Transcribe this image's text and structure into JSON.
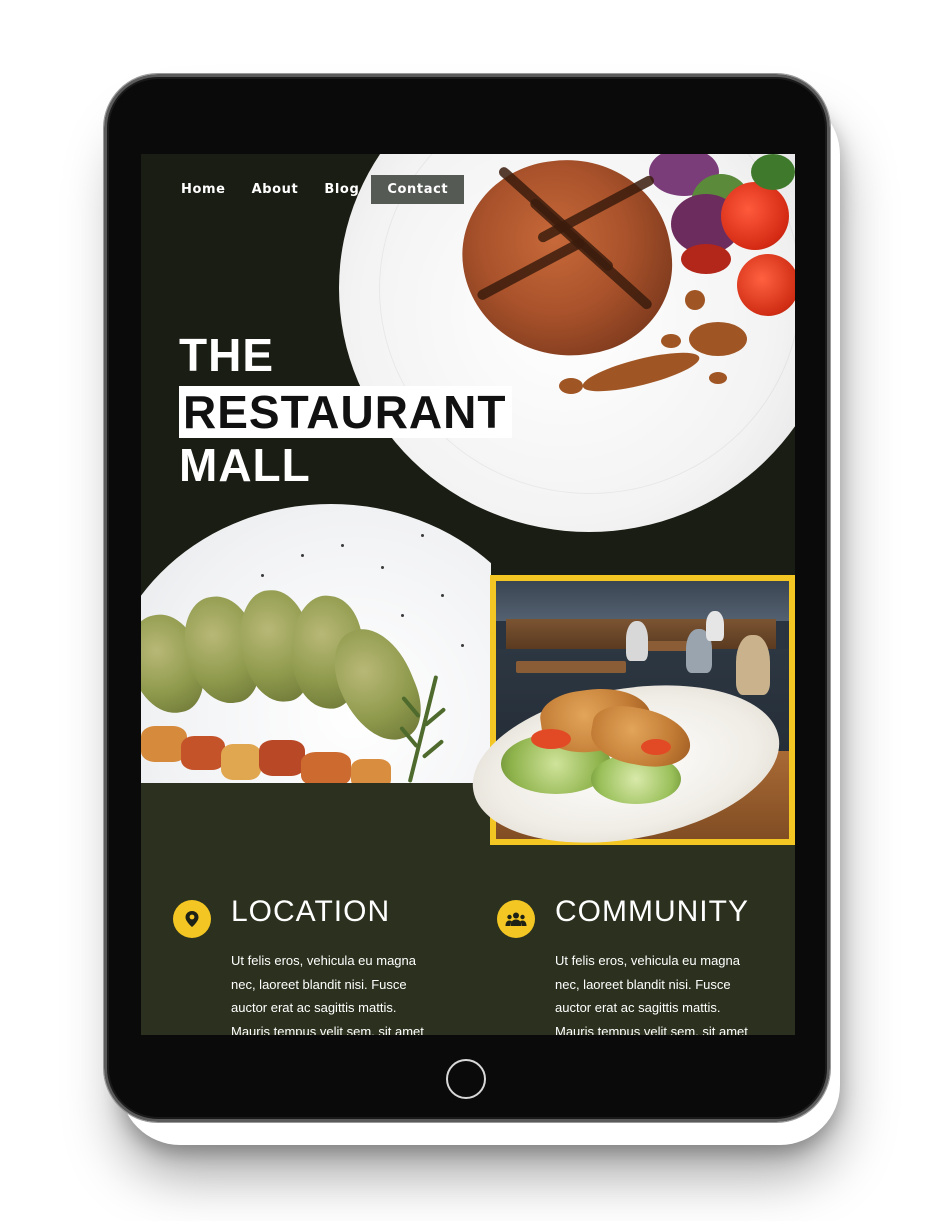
{
  "nav": {
    "items": [
      {
        "label": "Home"
      },
      {
        "label": "About"
      },
      {
        "label": "Blog"
      },
      {
        "label": "Contact"
      }
    ]
  },
  "hero": {
    "line1": "THE",
    "line2": "RESTAURANT",
    "line3": "MALL"
  },
  "features": [
    {
      "icon": "location-pin-icon",
      "heading": "LOCATION",
      "text": "Ut felis eros, vehicula eu magna nec, laoreet blandit nisi. Fusce auctor erat ac sagittis mattis. Mauris tempus velit sem, sit amet"
    },
    {
      "icon": "community-group-icon",
      "heading": "COMMUNITY",
      "text": "Ut felis eros, vehicula eu magna nec, laoreet blandit nisi. Fusce auctor erat ac sagittis mattis. Mauris tempus velit sem, sit amet"
    }
  ],
  "colors": {
    "accent": "#f3c623",
    "hero_bg": "#1a1d13",
    "lower_bg": "#2b311e",
    "nav_active_bg": "#565a55"
  }
}
